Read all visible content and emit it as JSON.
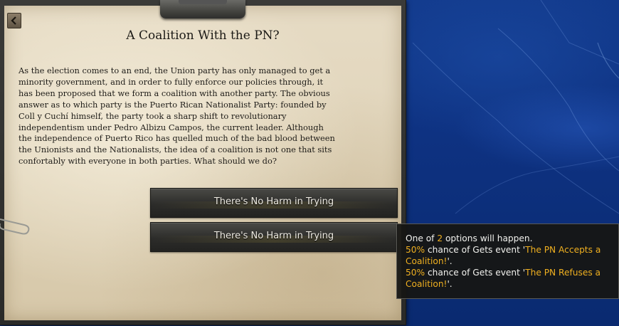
{
  "event": {
    "title": "A Coalition With the PN?",
    "description": "As the election comes to an end, the Union party has only managed to get a\nminority government, and in order to fully enforce our policies through, it\nhas been proposed that we form a coalition with another party. The obvious\nanswer as to which party is the Puerto Rican Nationalist Party: founded by\nColl y Cuchí himself, the party took a sharp shift to revolutionary\nindependentism under Pedro Albizu Campos, the current leader. Although\nthe independence of Puerto Rico has quelled much of the bad blood between\nthe Unionists and the Nationalists, the idea of a coalition is not one that sits\nconfortably with everyone in both parties. What should we do?",
    "options": [
      {
        "label": "There's No Harm in Trying"
      },
      {
        "label": "There's No Harm in Trying"
      }
    ]
  },
  "tooltip": {
    "line1_a": "One of ",
    "line1_num": "2",
    "line1_b": " options will happen.",
    "outcome1_pct": "50%",
    "outcome1_mid": " chance of Gets event '",
    "outcome1_name": "The PN Accepts a Coalition!",
    "outcome1_end": "'.",
    "outcome2_pct": "50%",
    "outcome2_mid": " chance of Gets event '",
    "outcome2_name": "The PN Refuses a Coalition!",
    "outcome2_end": "'."
  },
  "colors": {
    "accent": "#f0b020",
    "sea": "#0e3282",
    "paper": "#e0d4ba"
  },
  "icons": [
    "back-arrow-icon",
    "paperclip-icon"
  ]
}
